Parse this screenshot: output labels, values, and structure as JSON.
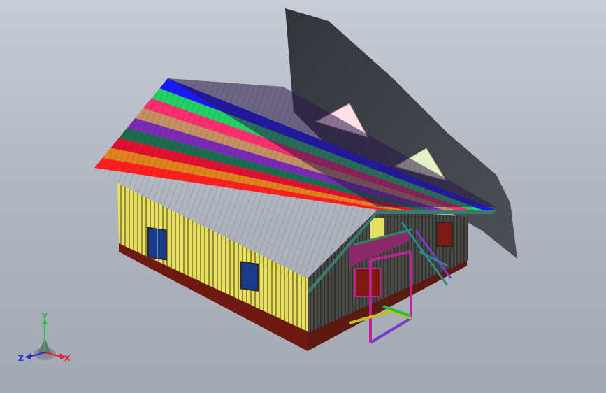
{
  "viewport": {
    "background_top": "#c8ccd4",
    "background_bottom": "#a4a9b3"
  },
  "model": {
    "object": "house-3d-model",
    "roof_stripe_colors": [
      "#1a1aff",
      "#22d166",
      "#ff2e6e",
      "#c49062",
      "#7a2bb5",
      "#1d6b4e",
      "#e01030",
      "#e0821a",
      "#ff2020"
    ],
    "wall_color": "#e8e060",
    "wall_dark_color": "#3a3a3a",
    "foundation_color": "#7a1a10",
    "gable_color": "#ffe0e0"
  },
  "triad": {
    "x_label": "X",
    "y_label": "Y",
    "z_label": "Z",
    "x_color": "#e0202a",
    "y_color": "#20c040",
    "z_color": "#2030e0"
  }
}
